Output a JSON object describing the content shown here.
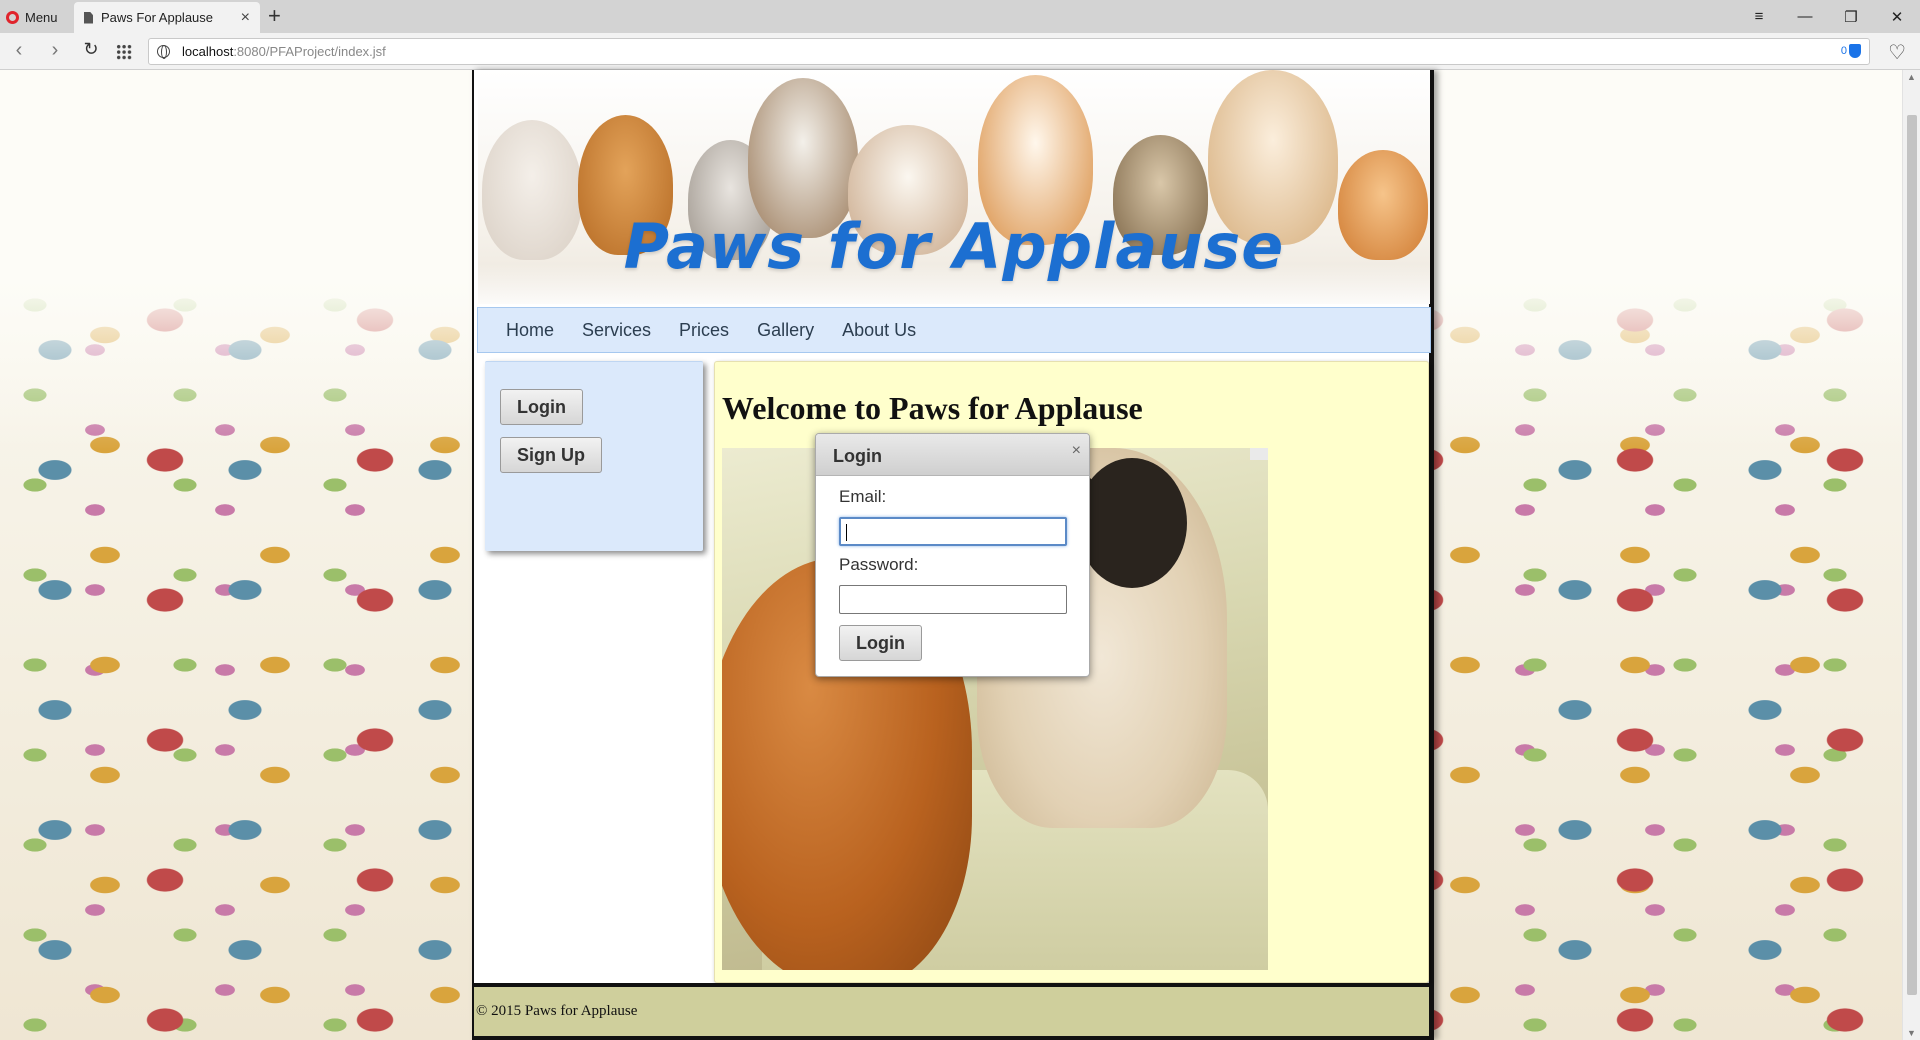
{
  "browser": {
    "menu_label": "Menu",
    "tab_title": "Paws For Applause",
    "tab_close": "×",
    "new_tab": "+",
    "url_host": "localhost",
    "url_path": ":8080/PFAProject/index.jsf",
    "vpn_count": "0",
    "window_controls": [
      "≡",
      "—",
      "❐",
      "✕"
    ]
  },
  "site": {
    "banner_title": "Paws for Applause",
    "nav": [
      "Home",
      "Services",
      "Prices",
      "Gallery",
      "About Us"
    ],
    "sidebar": {
      "login_label": "Login",
      "signup_label": "Sign Up"
    },
    "heading": "Welcome to Paws for Applause",
    "footer": "© 2015 Paws for Applause"
  },
  "dialog": {
    "title": "Login",
    "close": "×",
    "email_label": "Email:",
    "email_value": "",
    "password_label": "Password:",
    "password_value": "",
    "submit_label": "Login"
  },
  "colors": {
    "brand_blue": "#1c6fd1",
    "nav_bg": "#dbe9fb",
    "content_bg": "#ffffcc",
    "footer_bg": "#cfcf9c"
  }
}
